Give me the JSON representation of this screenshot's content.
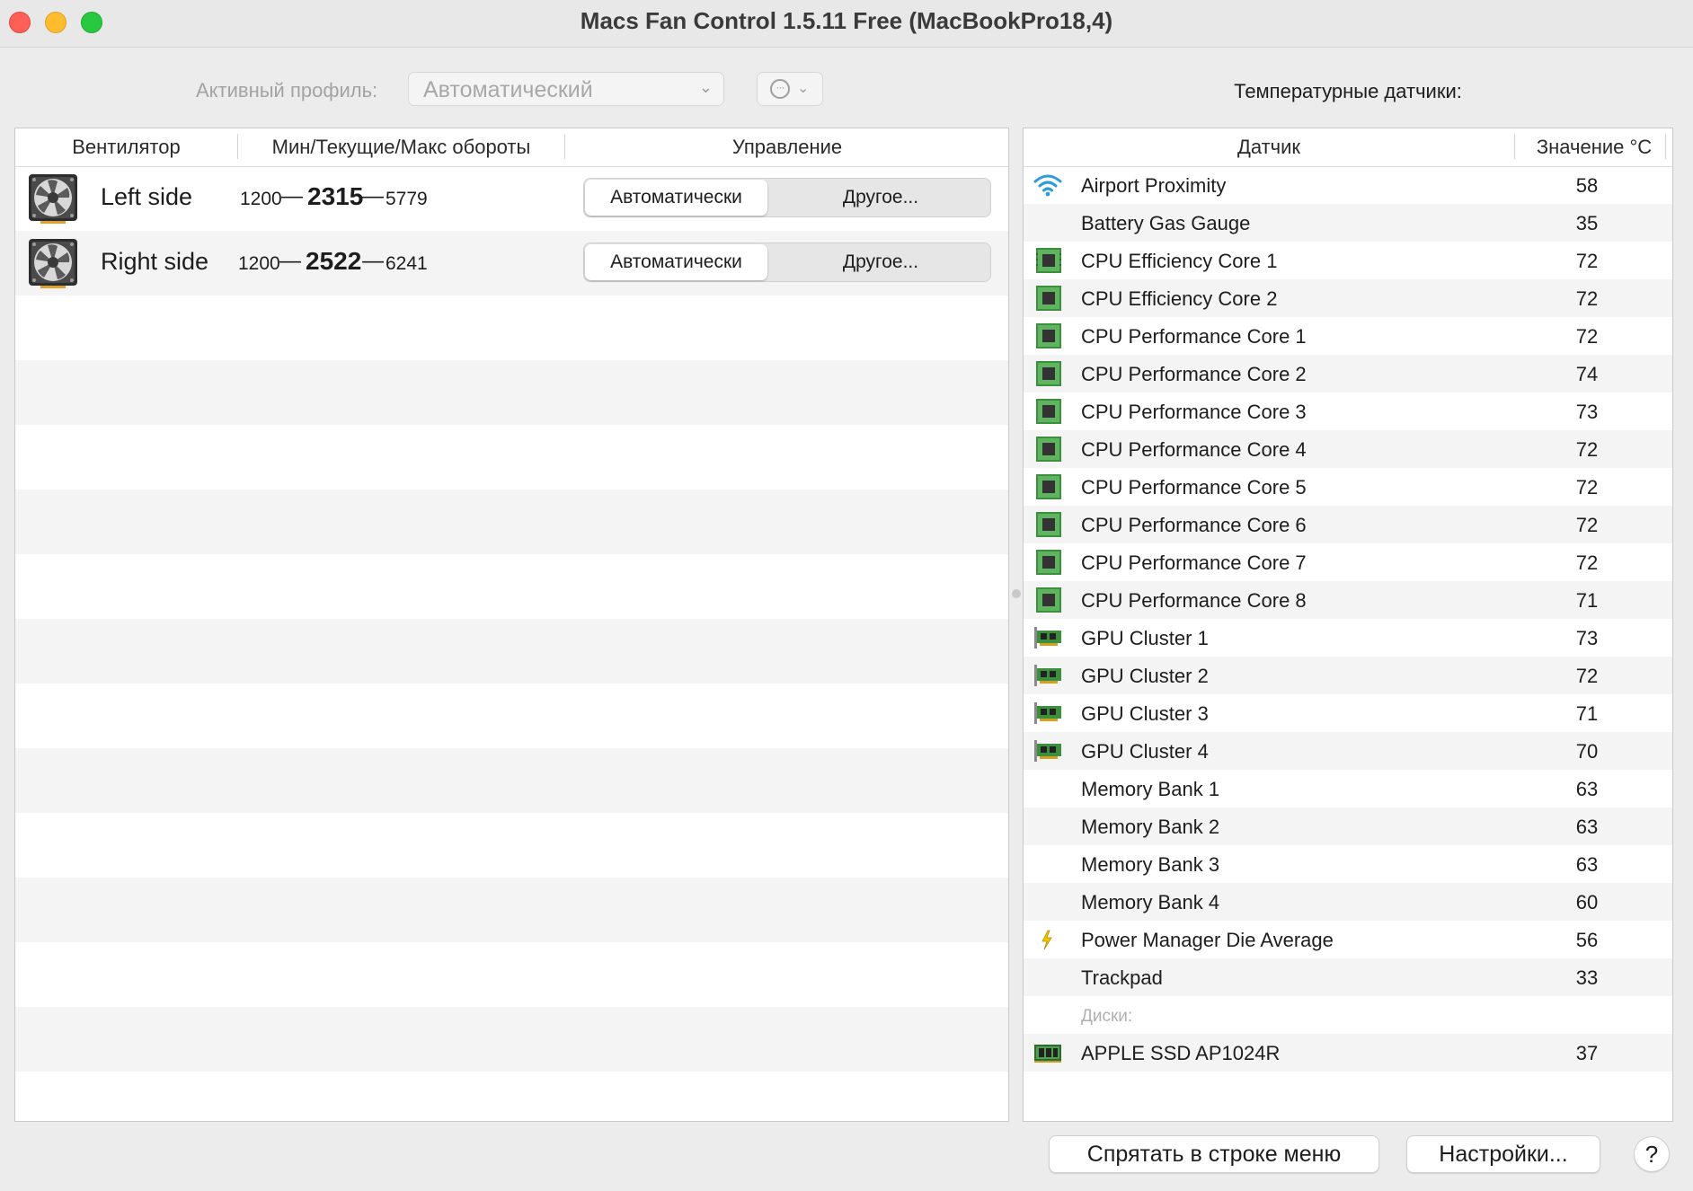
{
  "window": {
    "title": "Macs Fan Control 1.5.11 Free (MacBookPro18,4)"
  },
  "toolbar": {
    "profile_label": "Активный профиль:",
    "profile_value": "Автоматический",
    "more_icon": "ellipsis-circle-icon"
  },
  "fans": {
    "headers": {
      "fan": "Вентилятор",
      "rpm": "Мин/Текущие/Макс обороты",
      "control": "Управление"
    },
    "rows": [
      {
        "name": "Left side",
        "min": "1200",
        "current": "2315",
        "max": "5779",
        "auto_label": "Автоматически",
        "custom_label": "Другое..."
      },
      {
        "name": "Right side",
        "min": "1200",
        "current": "2522",
        "max": "6241",
        "auto_label": "Автоматически",
        "custom_label": "Другое..."
      }
    ],
    "dash": "—"
  },
  "sensors": {
    "title": "Температурные датчики:",
    "headers": {
      "sensor": "Датчик",
      "value": "Значение °C"
    },
    "rows": [
      {
        "name": "Airport Proximity",
        "value": "58",
        "icon": "wifi-icon"
      },
      {
        "name": "Battery Gas Gauge",
        "value": "35",
        "icon": ""
      },
      {
        "name": "CPU Efficiency Core 1",
        "value": "72",
        "icon": "cpu-chip-icon"
      },
      {
        "name": "CPU Efficiency Core 2",
        "value": "72",
        "icon": "cpu-chip-icon"
      },
      {
        "name": "CPU Performance Core 1",
        "value": "72",
        "icon": "cpu-chip-icon"
      },
      {
        "name": "CPU Performance Core 2",
        "value": "74",
        "icon": "cpu-chip-icon"
      },
      {
        "name": "CPU Performance Core 3",
        "value": "73",
        "icon": "cpu-chip-icon"
      },
      {
        "name": "CPU Performance Core 4",
        "value": "72",
        "icon": "cpu-chip-icon"
      },
      {
        "name": "CPU Performance Core 5",
        "value": "72",
        "icon": "cpu-chip-icon"
      },
      {
        "name": "CPU Performance Core 6",
        "value": "72",
        "icon": "cpu-chip-icon"
      },
      {
        "name": "CPU Performance Core 7",
        "value": "72",
        "icon": "cpu-chip-icon"
      },
      {
        "name": "CPU Performance Core 8",
        "value": "71",
        "icon": "cpu-chip-icon"
      },
      {
        "name": "GPU Cluster 1",
        "value": "73",
        "icon": "gpu-card-icon"
      },
      {
        "name": "GPU Cluster 2",
        "value": "72",
        "icon": "gpu-card-icon"
      },
      {
        "name": "GPU Cluster 3",
        "value": "71",
        "icon": "gpu-card-icon"
      },
      {
        "name": "GPU Cluster 4",
        "value": "70",
        "icon": "gpu-card-icon"
      },
      {
        "name": "Memory Bank 1",
        "value": "63",
        "icon": ""
      },
      {
        "name": "Memory Bank 2",
        "value": "63",
        "icon": ""
      },
      {
        "name": "Memory Bank 3",
        "value": "63",
        "icon": ""
      },
      {
        "name": "Memory Bank 4",
        "value": "60",
        "icon": ""
      },
      {
        "name": "Power Manager Die Average",
        "value": "56",
        "icon": "lightning-icon"
      },
      {
        "name": "Trackpad",
        "value": "33",
        "icon": ""
      }
    ],
    "disks_section": "Диски:",
    "disks": [
      {
        "name": "APPLE SSD AP1024R",
        "value": "37",
        "icon": "ssd-icon"
      }
    ]
  },
  "footer": {
    "hide_button": "Спрятать в строке меню",
    "settings_button": "Настройки...",
    "help_button": "?"
  },
  "colors": {
    "close": "#ff5f57",
    "minimize": "#febc2e",
    "maximize": "#28c840",
    "wifi": "#2e9bdc",
    "chip_green": "#3c8f3c",
    "lightning": "#f2c400"
  }
}
